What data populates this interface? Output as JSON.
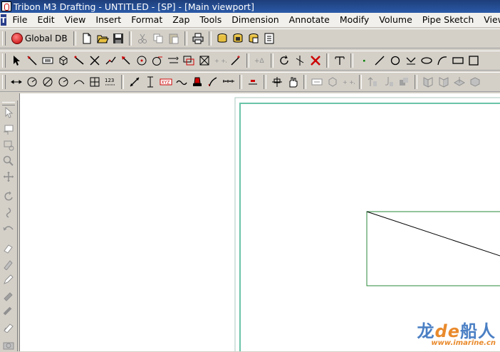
{
  "window": {
    "title": "Tribon M3 Drafting - UNTITLED - [SP] - [Main viewport]"
  },
  "menubar": {
    "items": [
      "File",
      "Edit",
      "View",
      "Insert",
      "Format",
      "Zap",
      "Tools",
      "Dimension",
      "Annotate",
      "Modify",
      "Volume",
      "Pipe Sketch",
      "Viewport"
    ]
  },
  "toolbar1": {
    "global_db_label": "Global DB"
  },
  "watermark": {
    "main_prefix": "龙",
    "main_de": "de",
    "main_suffix": "船人",
    "url": "www.imarine.cn"
  },
  "colors": {
    "title_bar": "#1e3e7a",
    "sheet_border": "#6ac4a8",
    "drawing_rect": "#2a8a3a",
    "workspace": "#ffffff"
  }
}
